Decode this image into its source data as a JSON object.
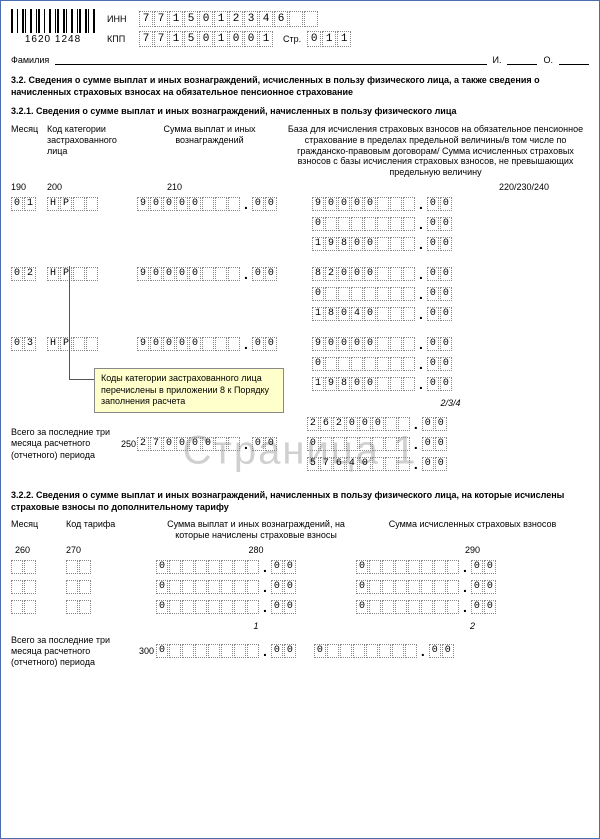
{
  "barcode_text": "1620 1248",
  "inn_label": "ИНН",
  "kpp_label": "КПП",
  "page_label": "Стр.",
  "inn": [
    "7",
    "7",
    "1",
    "5",
    "0",
    "1",
    "2",
    "3",
    "4",
    "6",
    "",
    ""
  ],
  "kpp": [
    "7",
    "7",
    "1",
    "5",
    "0",
    "1",
    "0",
    "0",
    "1"
  ],
  "page_num": [
    "0",
    "1",
    "1"
  ],
  "surname_label": "Фамилия",
  "i_label": "И.",
  "o_label": "О.",
  "section32": "3.2. Сведения о сумме выплат и иных вознаграждений, исчисленных в пользу физического лица, а также сведения о начисленных страховых взносах на обязательное   пенсионное страхование",
  "section321": "3.2.1. Сведения о сумме выплат и иных вознаграждений, начисленных в пользу физического лица",
  "h_month": "Месяц",
  "h_code": "Код категории застрахованного лица",
  "h_pay": "Сумма выплат и иных вознаграждений",
  "h_base": "База для исчисления страховых взносов на обязательное пенсионное страхование в пределах предельной величины/в том числе по гражданско-правовым договорам/ Сумма исчисленных страховых взносов с базы исчисления страховых взносов, не превышающих предельную величину",
  "c190": "190",
  "c200": "200",
  "c210": "210",
  "c220": "220/230/240",
  "tooltip_text": "Коды категории застрахованного лица перечислены в приложении 8 к Порядку заполнения расчета",
  "rows321": {
    "m1": [
      "0",
      "1"
    ],
    "m2": [
      "0",
      "2"
    ],
    "m3": [
      "0",
      "3"
    ],
    "code": [
      "Н",
      "Р",
      "",
      ""
    ],
    "pay_int": [
      "9",
      "0",
      "0",
      "0",
      "0",
      "",
      "",
      ""
    ],
    "pay_dec": [
      "0",
      "0"
    ],
    "b1a_int": [
      "9",
      "0",
      "0",
      "0",
      "0",
      "",
      "",
      ""
    ],
    "b1a_dec": [
      "0",
      "0"
    ],
    "b1b_int": [
      "0",
      "",
      "",
      "",
      "",
      "",
      "",
      ""
    ],
    "b1b_dec": [
      "0",
      "0"
    ],
    "b1c_int": [
      "1",
      "9",
      "8",
      "0",
      "0",
      "",
      "",
      ""
    ],
    "b1c_dec": [
      "0",
      "0"
    ],
    "b2a_int": [
      "8",
      "2",
      "0",
      "0",
      "0",
      "",
      "",
      ""
    ],
    "b2a_dec": [
      "0",
      "0"
    ],
    "b2b_int": [
      "0",
      "",
      "",
      "",
      "",
      "",
      "",
      ""
    ],
    "b2b_dec": [
      "0",
      "0"
    ],
    "b2c_int": [
      "1",
      "8",
      "0",
      "4",
      "0",
      "",
      "",
      ""
    ],
    "b2c_dec": [
      "0",
      "0"
    ],
    "b3a_int": [
      "9",
      "0",
      "0",
      "0",
      "0",
      "",
      "",
      ""
    ],
    "b3a_dec": [
      "0",
      "0"
    ],
    "b3b_int": [
      "0",
      "",
      "",
      "",
      "",
      "",
      "",
      ""
    ],
    "b3b_dec": [
      "0",
      "0"
    ],
    "b3c_int": [
      "1",
      "9",
      "8",
      "0",
      "0",
      "",
      "",
      ""
    ],
    "b3c_dec": [
      "0",
      "0"
    ]
  },
  "totals_label": "Всего за последние три месяца расчетного (отчетного) периода",
  "c250": "250",
  "sub1": "1",
  "sub234": "2/3/4",
  "sub2": "2",
  "t250_int": [
    "2",
    "7",
    "0",
    "0",
    "0",
    "0",
    "",
    ""
  ],
  "t250_dec": [
    "0",
    "0"
  ],
  "t_a_int": [
    "2",
    "6",
    "2",
    "0",
    "0",
    "0",
    "",
    ""
  ],
  "t_a_dec": [
    "0",
    "0"
  ],
  "t_b_int": [
    "0",
    "",
    "",
    "",
    "",
    "",
    "",
    ""
  ],
  "t_b_dec": [
    "0",
    "0"
  ],
  "t_c_int": [
    "5",
    "7",
    "6",
    "4",
    "0",
    "",
    "",
    ""
  ],
  "t_c_dec": [
    "0",
    "0"
  ],
  "section322": "3.2.2. Сведения о сумме выплат и иных вознаграждений, начисленных в пользу физического лица, на которые исчислены страховые взносы по дополнительному тарифу",
  "h322_month": "Месяц",
  "h322_tariff": "Код тарифа",
  "h322_pay": "Сумма выплат и иных вознаграждений, на которые начислены страховые взносы",
  "h322_sum": "Сумма исчисленных страховых взносов",
  "c260": "260",
  "c270": "270",
  "c280": "280",
  "c290": "290",
  "c300": "300",
  "empty2": [
    "",
    ""
  ],
  "zero_int": [
    "0",
    "",
    "",
    "",
    "",
    "",
    "",
    ""
  ],
  "zero_dec": [
    "0",
    "0"
  ],
  "totals322_label": "Всего за последние три месяца расчетного (отчетного) периода"
}
